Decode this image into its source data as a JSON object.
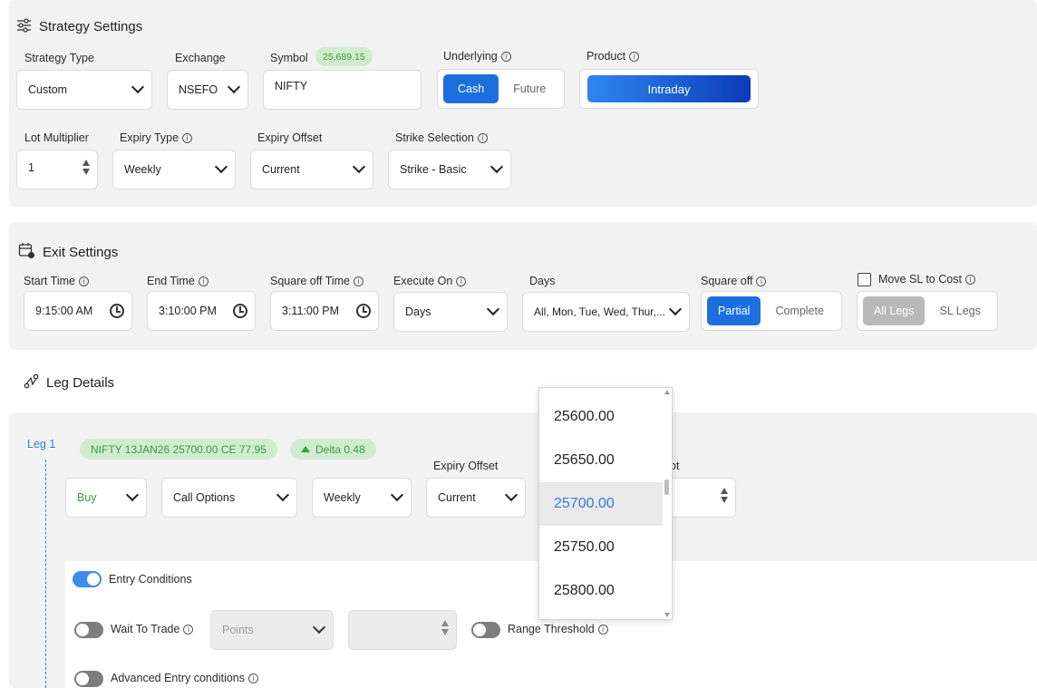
{
  "strategy_settings": {
    "title": "Strategy Settings",
    "icon": "sliders-icon",
    "strategy_type": {
      "label": "Strategy Type",
      "value": "Custom"
    },
    "exchange": {
      "label": "Exchange",
      "value": "NSEFO"
    },
    "symbol": {
      "label": "Symbol",
      "price": "25,689.15",
      "value": "NIFTY"
    },
    "underlying": {
      "label": "Underlying",
      "options": [
        "Cash",
        "Future"
      ],
      "selected": "Cash"
    },
    "product": {
      "label": "Product",
      "value": "Intraday"
    },
    "lot_multiplier": {
      "label": "Lot Multiplier",
      "value": "1"
    },
    "expiry_type": {
      "label": "Expiry Type",
      "value": "Weekly"
    },
    "expiry_offset": {
      "label": "Expiry Offset",
      "value": "Current"
    },
    "strike_selection": {
      "label": "Strike Selection",
      "value": "Strike - Basic"
    }
  },
  "exit_settings": {
    "title": "Exit Settings",
    "icon": "calendar-clock-icon",
    "start_time": {
      "label": "Start Time",
      "value": "9:15:00 AM"
    },
    "end_time": {
      "label": "End Time",
      "value": "3:10:00 PM"
    },
    "square_off_time": {
      "label": "Square off Time",
      "value": "3:11:00 PM"
    },
    "execute_on": {
      "label": "Execute On",
      "value": "Days"
    },
    "days": {
      "label": "Days",
      "value": "All, Mon, Tue, Wed, Thur,..."
    },
    "square_off": {
      "label": "Square off",
      "options": [
        "Partial",
        "Complete"
      ],
      "selected": "Partial"
    },
    "move_sl_to_cost": {
      "label": "Move SL to Cost",
      "checked": false,
      "options": [
        "All Legs",
        "SL Legs"
      ],
      "selected": "All Legs"
    }
  },
  "leg_details": {
    "title": "Leg Details",
    "icon": "route-icon",
    "leg": {
      "label": "Leg 1",
      "instrument_chip": "NIFTY 13JAN26 25700.00 CE 77.95",
      "delta_chip": "Delta 0.48",
      "side": "Buy",
      "option_type": "Call Options",
      "expiry": "Weekly",
      "expiry_offset_label": "Expiry Offset",
      "expiry_offset": "Current",
      "lot_label_partial": "ot"
    },
    "entry_conditions": {
      "label": "Entry Conditions",
      "on": true
    },
    "wait_to_trade": {
      "label": "Wait To Trade",
      "on": false,
      "unit_placeholder": "Points"
    },
    "range_threshold": {
      "label": "Range Threshold",
      "on": false
    },
    "advanced_entry": {
      "label": "Advanced Entry conditions",
      "on": false
    }
  },
  "strike_dropdown": {
    "options": [
      "25600.00",
      "25650.00",
      "25700.00",
      "25750.00",
      "25800.00"
    ],
    "selected": "25700.00"
  },
  "colors": {
    "accent": "#1d6fe0",
    "chip_green_bg": "#cfeccf",
    "chip_green_text": "#3f9a3f",
    "panel_bg": "#f2f2f2"
  }
}
